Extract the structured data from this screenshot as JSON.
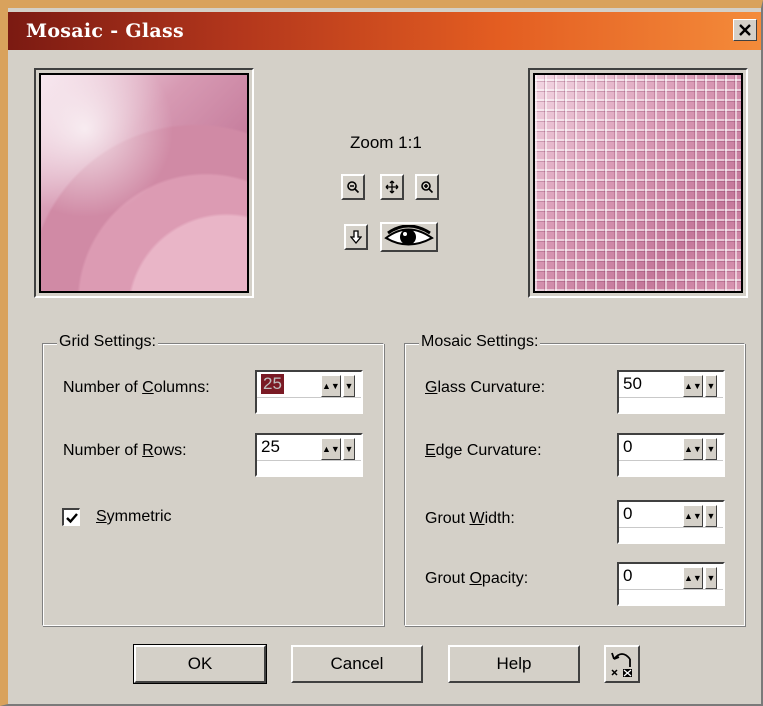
{
  "window": {
    "title": "Mosaic - Glass",
    "close_icon": "close-icon"
  },
  "preview": {
    "zoom_label": "Zoom 1:1",
    "tools": [
      "zoom-out-icon",
      "pan-icon",
      "zoom-in-icon",
      "proof-arrow-icon",
      "eye-preview-icon"
    ]
  },
  "grid_settings": {
    "title": "Grid Settings:",
    "columns_label_pre": "Number of ",
    "columns_label_u": "C",
    "columns_label_post": "olumns:",
    "columns_value": "25",
    "rows_label_pre": "Number of ",
    "rows_label_u": "R",
    "rows_label_post": "ows:",
    "rows_value": "25",
    "symmetric_label_u": "S",
    "symmetric_label_post": "ymmetric",
    "symmetric_checked": true
  },
  "mosaic_settings": {
    "title": "Mosaic Settings:",
    "glass_curvature_u": "G",
    "glass_curvature_post": "lass Curvature:",
    "glass_curvature_value": "50",
    "edge_curvature_u": "E",
    "edge_curvature_post": "dge Curvature:",
    "edge_curvature_value": "0",
    "grout_width_pre": "Grout ",
    "grout_width_u": "W",
    "grout_width_post": "idth:",
    "grout_width_value": "0",
    "grout_opacity_pre": "Grout ",
    "grout_opacity_u": "O",
    "grout_opacity_post": "pacity:",
    "grout_opacity_value": "0"
  },
  "buttons": {
    "ok": "OK",
    "cancel": "Cancel",
    "help": "Help",
    "reset_icon": "reset-defaults-icon"
  },
  "colors": {
    "title_gradient_start": "#7b1a12",
    "title_gradient_end": "#f48b3a",
    "dialog_face": "#d4d0c8",
    "selection": "#7a1a24"
  }
}
